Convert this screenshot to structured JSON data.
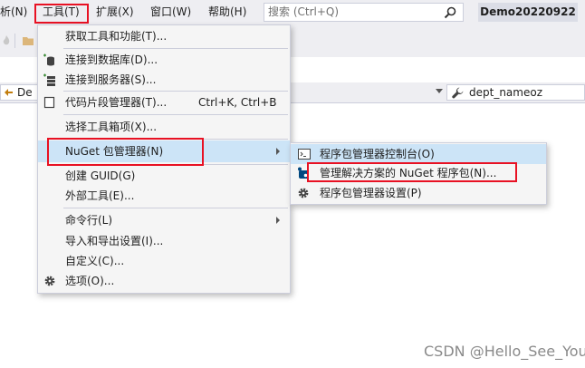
{
  "menubar": {
    "items": [
      "析(N)",
      "工具(T)",
      "扩展(X)",
      "窗口(W)",
      "帮助(H)"
    ],
    "search_placeholder": "搜索 (Ctrl+Q)",
    "project_name": "Demo20220922"
  },
  "navbar": {
    "left_combo": "De",
    "right_combo": "dept_nameoz"
  },
  "tools_menu": {
    "items": [
      {
        "label": "获取工具和功能(T)..."
      },
      {
        "label": "连接到数据库(D)..."
      },
      {
        "label": "连接到服务器(S)..."
      },
      {
        "label": "代码片段管理器(T)...",
        "shortcut": "Ctrl+K, Ctrl+B"
      },
      {
        "label": "选择工具箱项(X)..."
      },
      {
        "label": "NuGet 包管理器(N)"
      },
      {
        "label": "创建 GUID(G)"
      },
      {
        "label": "外部工具(E)..."
      },
      {
        "label": "命令行(L)"
      },
      {
        "label": "导入和导出设置(I)..."
      },
      {
        "label": "自定义(C)..."
      },
      {
        "label": "选项(O)..."
      }
    ]
  },
  "nuget_submenu": {
    "items": [
      {
        "label": "程序包管理器控制台(O)"
      },
      {
        "label": "管理解决方案的 NuGet 程序包(N)..."
      },
      {
        "label": "程序包管理器设置(P)"
      }
    ]
  },
  "colors": {
    "highlight": "#cce4f7",
    "annotation_red": "#e81123",
    "menubar_bg": "#eeeef2"
  },
  "watermark": "CSDN @Hello_See_You"
}
